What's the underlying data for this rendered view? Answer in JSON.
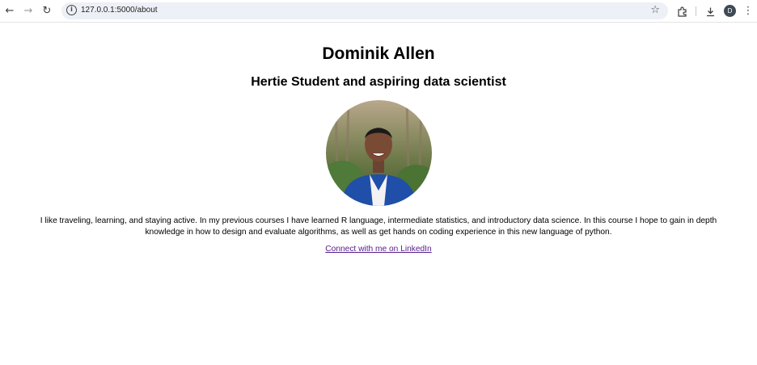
{
  "browser": {
    "url": "127.0.0.1:5000/about",
    "profile_initial": "D",
    "icons": [
      "back-icon",
      "forward-icon",
      "reload-icon",
      "site-info-icon",
      "bookmark-star-icon",
      "extensions-icon",
      "download-icon",
      "menu-icon"
    ]
  },
  "profile": {
    "name": "Dominik Allen",
    "tagline": "Hertie Student and aspiring data scientist",
    "bio": "I like traveling, learning, and staying active. In my previous courses I have learned R language, intermediate statistics, and introductory data science. In this course I hope to gain in depth knowledge in how to design and evaluate algorithms, as well as get hands on coding experience in this new language of python.",
    "link_label": "Connect with me on LinkedIn"
  },
  "colors": {
    "link_visited": "#551a8b",
    "omnibox_bg": "#edf0f6",
    "avatar_bg": "#3e4a55",
    "jacket": "#1f4fa8"
  }
}
